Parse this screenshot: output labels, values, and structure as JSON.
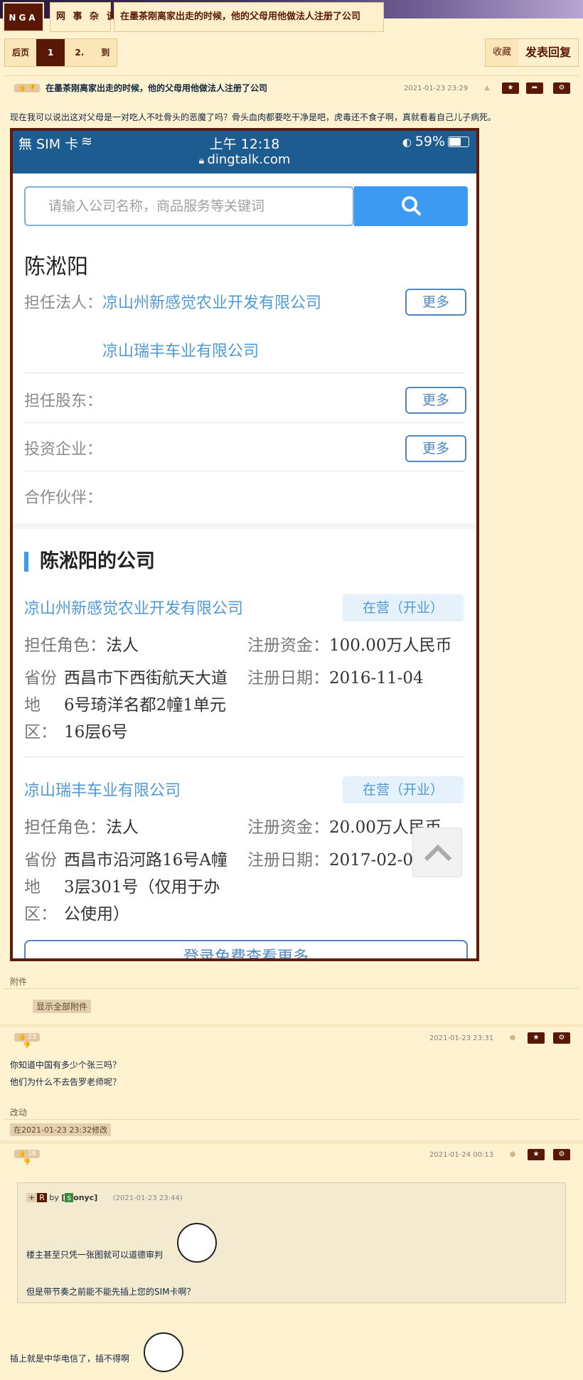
{
  "header": {
    "logo": "NGA",
    "forum": "网 事 杂 谈",
    "thread_title": "在墨茶刚离家出走的时候，他的父母用他做法人注册了公司"
  },
  "pager": {
    "prev": "后页",
    "current": "1",
    "next": "2.",
    "goto": "到"
  },
  "toolbar": {
    "favorite": "收藏",
    "reply": "发表回复"
  },
  "post1": {
    "title": "在墨茶刚离家出走的时候，他的父母用他做法人注册了公司",
    "date": "2021-01-23 23:29",
    "text": "现在我可以说出这对父母是一对吃人不吐骨头的恶魔了吗？骨头血肉都要吃干净是吧，虎毒还不食子啊，真就看着自己儿子病死。"
  },
  "phone": {
    "carrier": "無 SIM 卡",
    "time": "上午 12:18",
    "battery": "59%",
    "url": "dingtalk.com",
    "search_placeholder": "请输入公司名称，商品服务等关键词",
    "person_name": "陈淞阳",
    "legal_label": "担任法人：",
    "legal_company_1": "凉山州新感觉农业开发有限公司",
    "legal_company_2": "凉山瑞丰车业有限公司",
    "shareholder_label": "担任股东：",
    "invest_label": "投资企业：",
    "partner_label": "合作伙伴：",
    "more": "更多",
    "companies_title": "陈淞阳的公司",
    "companies": [
      {
        "name": "凉山州新感觉农业开发有限公司",
        "status": "在营（开业）",
        "role_label": "担任角色：",
        "role": "法人",
        "capital_label": "注册资金：",
        "capital": "100.00万人民币",
        "region_label_1": "省份",
        "region_label_2": "地",
        "region_label_3": "区：",
        "address_1": "西昌市下西街航天大道",
        "address_2": "6号琦洋名都2幢1单元",
        "address_3": "16层6号",
        "date_label": "注册日期：",
        "date": "2016-11-04"
      },
      {
        "name": "凉山瑞丰车业有限公司",
        "status": "在营（开业）",
        "role_label": "担任角色：",
        "role": "法人",
        "capital_label": "注册资金：",
        "capital": "20.00万人民币",
        "region_label_1": "省份",
        "region_label_2": "地",
        "region_label_3": "区：",
        "address_1": "西昌市沿河路16号A幢",
        "address_2": "3层301号（仅用于办",
        "address_3": "公使用）",
        "date_label": "注册日期：",
        "date": "2017-02-0"
      }
    ],
    "login_more": "登录免费查看更多"
  },
  "attachments": {
    "label": "附件",
    "show_all": "显示全部附件"
  },
  "post2": {
    "likes": "23",
    "date": "2021-01-23 23:31",
    "line1": "你知道中国有多少个张三吗？",
    "line2": "他们为什么不去告罗老师呢？",
    "edit_label": "改动",
    "edit_note": "在2021-01-23 23:32修改"
  },
  "post3": {
    "likes": "18",
    "date": "2021-01-24 00:13",
    "quote_r": "R",
    "quote_by": "by",
    "quote_user_badge": "s",
    "quote_user": "onyc]",
    "quote_open": "[",
    "quote_time": "(2021-01-23 23:44)",
    "quote_line1": "楼主甚至只凭一张图就可以道德审判",
    "quote_line2": "但是带节奏之前能不能先插上您的SIM卡啊？",
    "reply_text": "插上就是中华电信了，插不得啊"
  }
}
